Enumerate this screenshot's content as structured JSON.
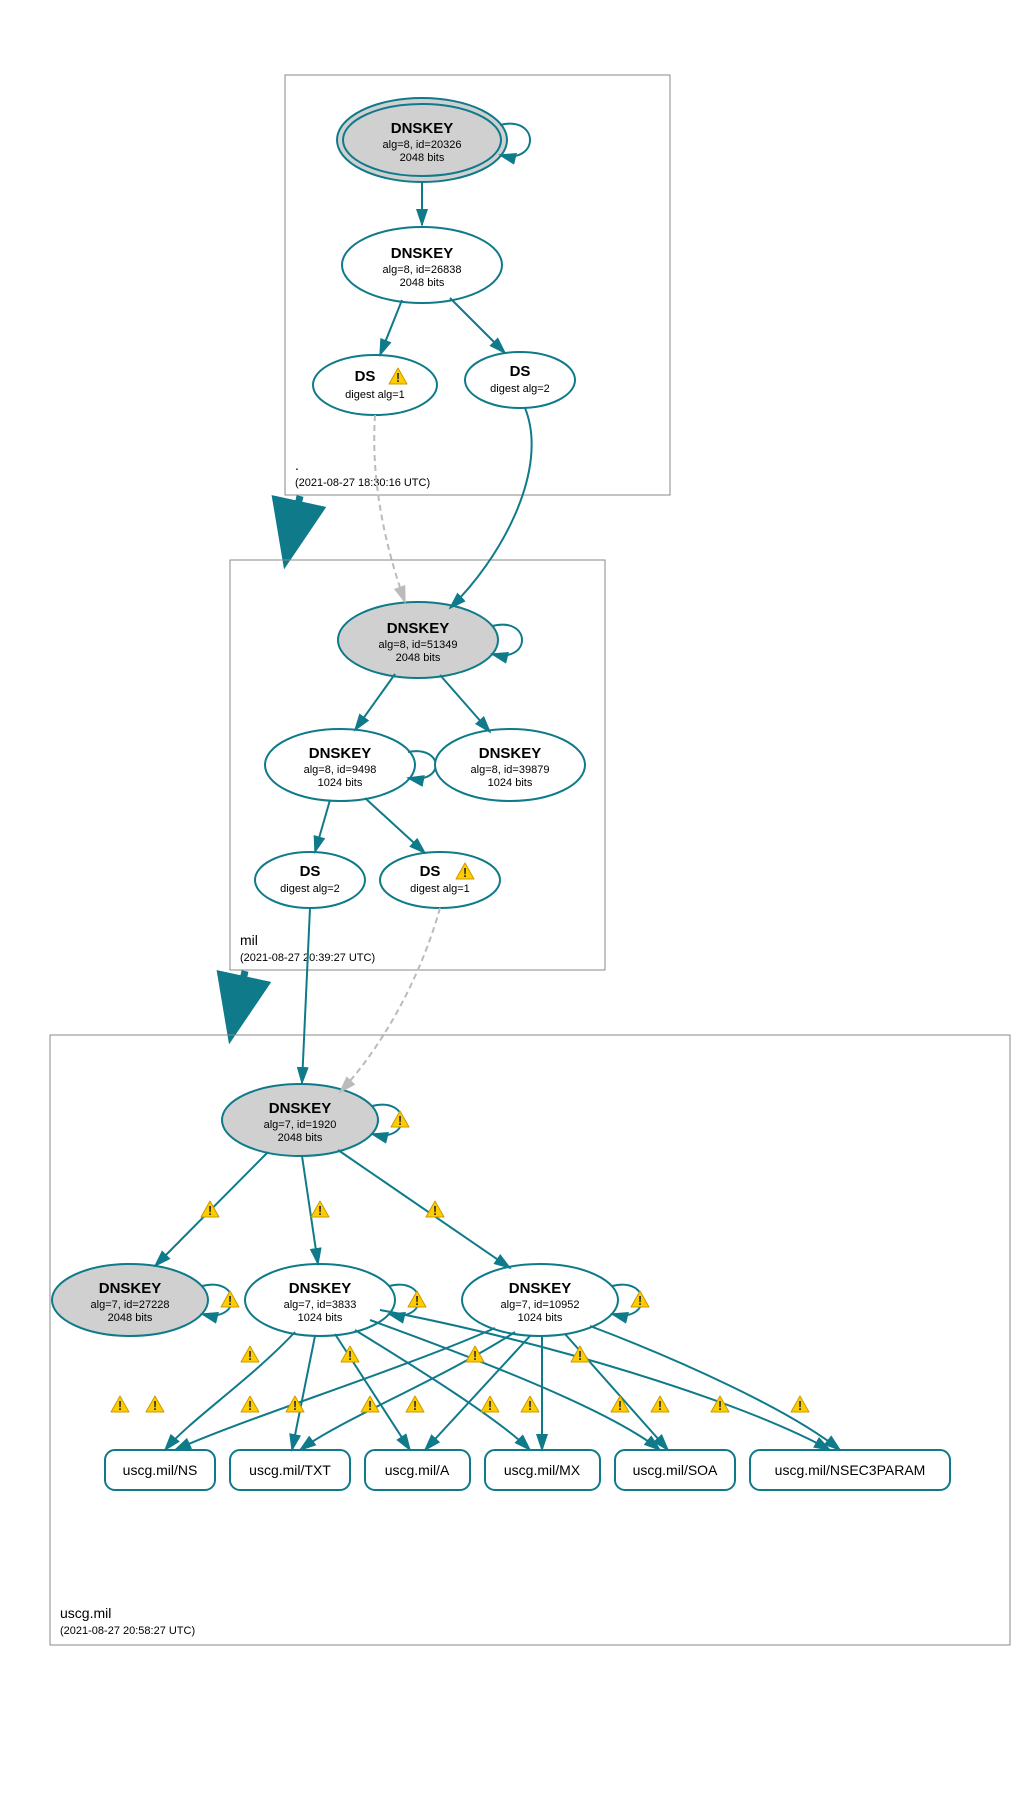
{
  "zones": {
    "root": {
      "name": ".",
      "timestamp": "(2021-08-27 18:30:16 UTC)"
    },
    "mil": {
      "name": "mil",
      "timestamp": "(2021-08-27 20:39:27 UTC)"
    },
    "uscg": {
      "name": "uscg.mil",
      "timestamp": "(2021-08-27 20:58:27 UTC)"
    }
  },
  "nodes": {
    "root_ksk": {
      "title": "DNSKEY",
      "line1": "alg=8, id=20326",
      "line2": "2048 bits"
    },
    "root_zsk": {
      "title": "DNSKEY",
      "line1": "alg=8, id=26838",
      "line2": "2048 bits"
    },
    "root_ds1": {
      "title": "DS",
      "line1": "digest alg=1"
    },
    "root_ds2": {
      "title": "DS",
      "line1": "digest alg=2"
    },
    "mil_ksk": {
      "title": "DNSKEY",
      "line1": "alg=8, id=51349",
      "line2": "2048 bits"
    },
    "mil_zsk1": {
      "title": "DNSKEY",
      "line1": "alg=8, id=9498",
      "line2": "1024 bits"
    },
    "mil_zsk2": {
      "title": "DNSKEY",
      "line1": "alg=8, id=39879",
      "line2": "1024 bits"
    },
    "mil_ds1": {
      "title": "DS",
      "line1": "digest alg=2"
    },
    "mil_ds2": {
      "title": "DS",
      "line1": "digest alg=1"
    },
    "uscg_ksk": {
      "title": "DNSKEY",
      "line1": "alg=7, id=1920",
      "line2": "2048 bits"
    },
    "uscg_27228": {
      "title": "DNSKEY",
      "line1": "alg=7, id=27228",
      "line2": "2048 bits"
    },
    "uscg_3833": {
      "title": "DNSKEY",
      "line1": "alg=7, id=3833",
      "line2": "1024 bits"
    },
    "uscg_10952": {
      "title": "DNSKEY",
      "line1": "alg=7, id=10952",
      "line2": "1024 bits"
    }
  },
  "records": {
    "ns": "uscg.mil/NS",
    "txt": "uscg.mil/TXT",
    "a": "uscg.mil/A",
    "mx": "uscg.mil/MX",
    "soa": "uscg.mil/SOA",
    "nsec": "uscg.mil/NSEC3PARAM"
  }
}
